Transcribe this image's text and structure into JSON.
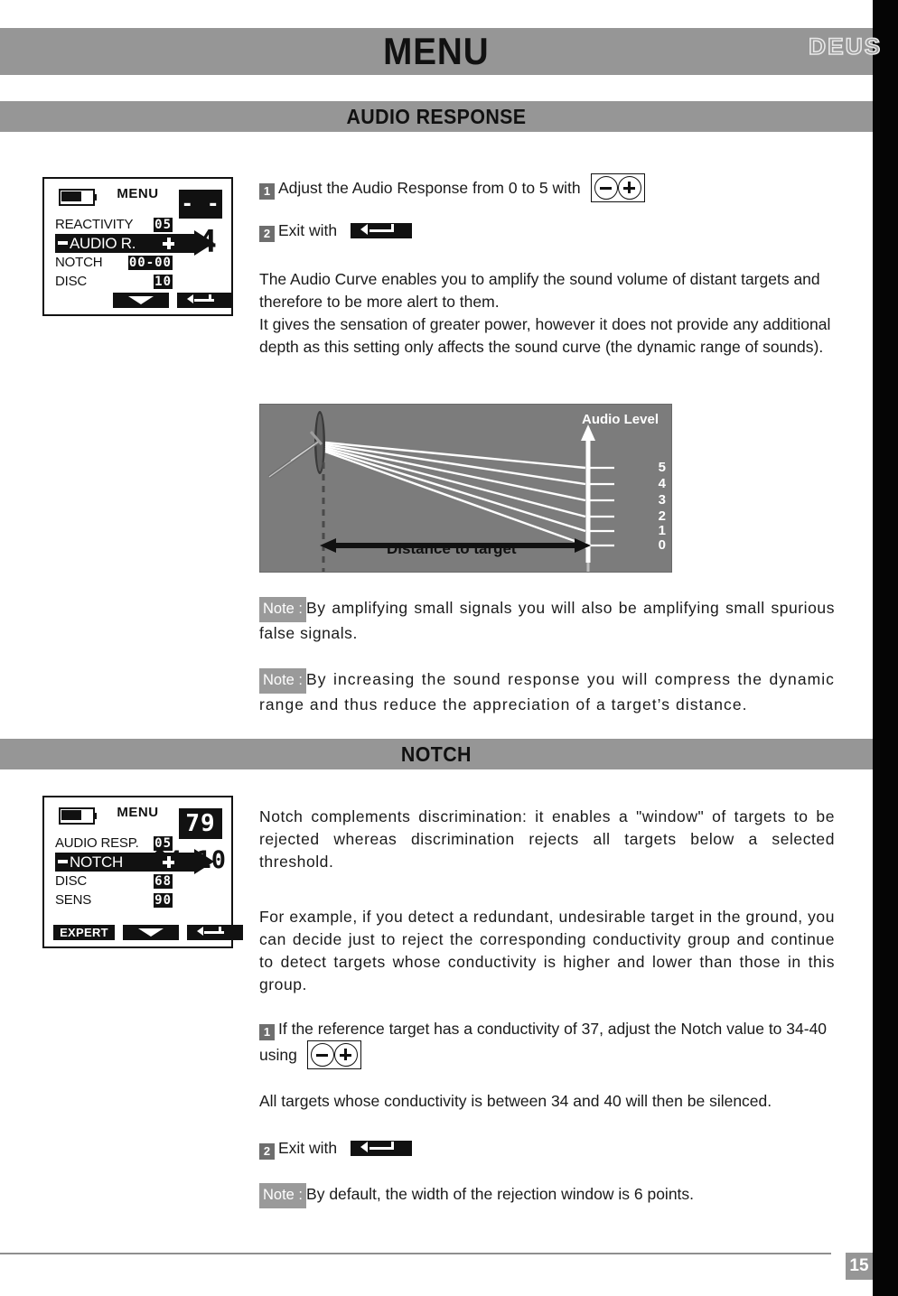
{
  "header": {
    "title": "MENU",
    "brand": "DEUS"
  },
  "sections": [
    {
      "id": "audio",
      "title": "AUDIO RESPONSE"
    },
    {
      "id": "notch",
      "title": "NOTCH"
    }
  ],
  "lcd_audio": {
    "menu_label": "MENU",
    "rows": [
      {
        "label": "REACTIVITY",
        "value": "05"
      },
      {
        "label": "AUDIO R.",
        "value": "",
        "selected": true
      },
      {
        "label": "NOTCH",
        "value": "00-00"
      },
      {
        "label": "DISC",
        "value": "10"
      }
    ],
    "seg_top": "- -",
    "seg_bottom": "4",
    "softkeys": [
      "down",
      "back"
    ]
  },
  "lcd_notch": {
    "menu_label": "MENU",
    "rows": [
      {
        "label": "AUDIO RESP.",
        "value": "05"
      },
      {
        "label": "NOTCH",
        "value": "",
        "selected": true
      },
      {
        "label": "DISC",
        "value": "68"
      },
      {
        "label": "SENS",
        "value": "90"
      }
    ],
    "seg_top": "79",
    "seg_bottom": "04-10",
    "expert_label": "EXPERT",
    "softkeys": [
      "expert",
      "down",
      "back"
    ]
  },
  "audio_section": {
    "step1": {
      "num": "1",
      "text": "Adjust the Audio Response from 0 to 5 with"
    },
    "step2": {
      "num": "2",
      "text": "Exit with"
    },
    "paragraph": "The Audio Curve enables you to amplify the sound volume of distant targets and therefore to be more alert to them.\nIt gives the sensation of greater power, however it does not provide any additional depth as this setting only affects the sound curve (the dynamic range of sounds).",
    "note1": {
      "tag": "Note :",
      "text": "By amplifying small signals you will also be amplifying small spurious false signals."
    },
    "note2": {
      "tag": "Note :",
      "text": "By increasing the sound response you will compress the dynamic range and thus reduce the appreciation of a target’s distance."
    }
  },
  "chart_data": {
    "type": "line",
    "title": "",
    "xlabel": "Distance to target",
    "ylabel": "Audio Level",
    "tick_labels": [
      "5",
      "4",
      "3",
      "2",
      "1",
      "0"
    ],
    "values": [
      5,
      4,
      3,
      2,
      1,
      0
    ],
    "series": [
      {
        "name": "curve-5",
        "value": 5
      },
      {
        "name": "curve-4",
        "value": 4
      },
      {
        "name": "curve-3",
        "value": 3
      },
      {
        "name": "curve-2",
        "value": 2
      },
      {
        "name": "curve-1",
        "value": 1
      },
      {
        "name": "curve-0",
        "value": 0
      }
    ],
    "grid": false,
    "legend": "none",
    "background": "#7c7c7c",
    "line_color": "#ffffff",
    "arrow_color": "#111111",
    "annotation": "Six audio response curves radiate from the detector coil to audio levels 0 through 5 on the vertical axis."
  },
  "notch_section": {
    "paragraph1": "Notch complements discrimination: it enables a \"window\" of targets to be rejected whereas discrimination rejects all targets below a selected threshold.",
    "paragraph2": "For example, if you detect a redundant, undesirable target in the ground, you can decide just to reject the corresponding conductivity group and continue to detect targets whose conductivity is higher and lower than those in this group.",
    "step1": {
      "num": "1",
      "text_before": "If the reference target has a conductivity of 37, adjust the Notch value to 34-40 using"
    },
    "statement": "All targets whose conductivity is between 34 and 40 will then be silenced.",
    "step2": {
      "num": "2",
      "text": "Exit with"
    },
    "note": {
      "tag": "Note :",
      "text": "By default, the width of the rejection window is 6 points."
    }
  },
  "footer": {
    "page_number": "15"
  },
  "colors": {
    "banner_gray": "#969696",
    "figure_bg": "#7c7c7c",
    "badge_gray": "#6e6e6e",
    "note_gray": "#9a9a9a",
    "ink": "#1a1a1a"
  }
}
